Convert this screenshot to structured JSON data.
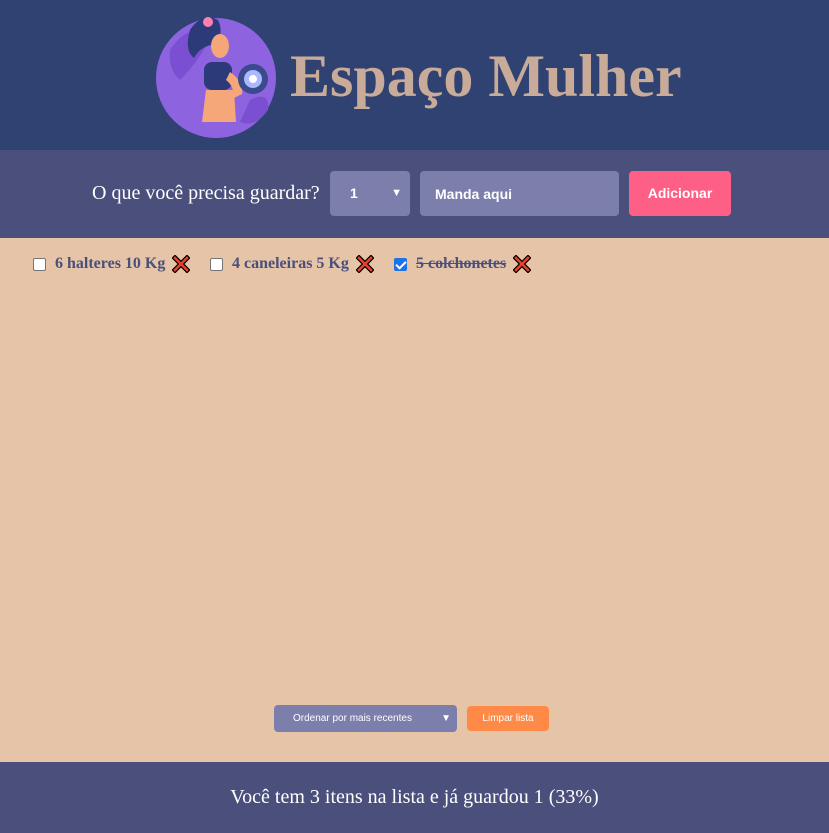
{
  "header": {
    "logo_icon": "woman-lifting-dumbbell-icon",
    "title": "Espaço Mulher"
  },
  "form": {
    "label": "O que você precisa guardar?",
    "quantity_value": "1",
    "item_placeholder": "Manda aqui",
    "add_label": "Adicionar"
  },
  "items": [
    {
      "label": "6 halteres 10 Kg",
      "checked": false
    },
    {
      "label": "4 caneleiras 5 Kg",
      "checked": false
    },
    {
      "label": "5 colchonetes",
      "checked": true
    }
  ],
  "controls": {
    "order_label": "Ordenar por mais recentes",
    "clear_label": "Limpar lista"
  },
  "footer": {
    "stats": "Você tem 3 itens na lista e já guardou 1 (33%)"
  },
  "colors": {
    "header_bg": "#2f4272",
    "bar_bg": "#4a4f7c",
    "page_bg": "#e5c4a8",
    "title": "#c9ab99",
    "add_button": "#fe5f86",
    "clear_button": "#ff8a48",
    "field_bg": "#7c7fab"
  }
}
